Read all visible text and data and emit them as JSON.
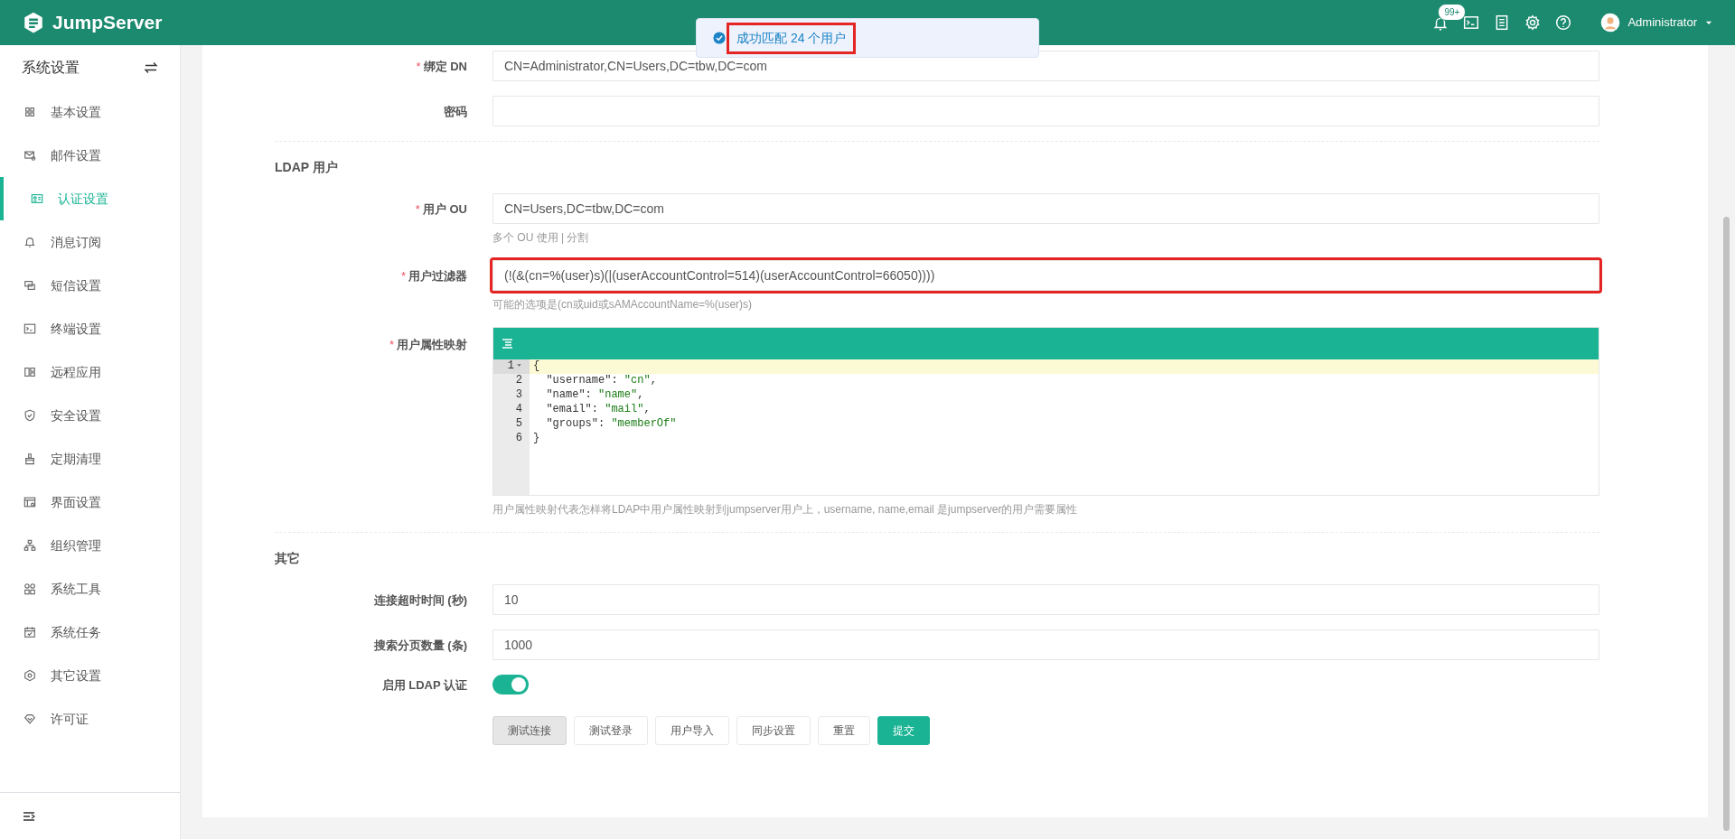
{
  "header": {
    "logo": "JumpServer",
    "notification_count": "99+",
    "user": "Administrator"
  },
  "toast": {
    "message": "成功匹配 24 个用户",
    "highlighted": true
  },
  "sidebar": {
    "title": "系统设置",
    "items": [
      {
        "label": "基本设置",
        "selected": false
      },
      {
        "label": "邮件设置",
        "selected": false
      },
      {
        "label": "认证设置",
        "selected": true
      },
      {
        "label": "消息订阅",
        "selected": false
      },
      {
        "label": "短信设置",
        "selected": false
      },
      {
        "label": "终端设置",
        "selected": false
      },
      {
        "label": "远程应用",
        "selected": false
      },
      {
        "label": "安全设置",
        "selected": false
      },
      {
        "label": "定期清理",
        "selected": false
      },
      {
        "label": "界面设置",
        "selected": false
      },
      {
        "label": "组织管理",
        "selected": false
      },
      {
        "label": "系统工具",
        "selected": false
      },
      {
        "label": "系统任务",
        "selected": false
      },
      {
        "label": "其它设置",
        "selected": false
      },
      {
        "label": "许可证",
        "selected": false
      }
    ]
  },
  "form": {
    "sections": [
      {
        "rows": [
          {
            "kind": "input",
            "marker": "*",
            "label": "绑定 DN",
            "value": "CN=Administrator,CN=Users,DC=tbw,DC=com",
            "highlighted": false
          },
          {
            "kind": "input",
            "label": "密码",
            "highlighted": false
          }
        ]
      },
      {
        "title": "LDAP 用户",
        "rows": [
          {
            "kind": "input",
            "marker": "*",
            "label": "用户 OU",
            "value": "CN=Users,DC=tbw,DC=com",
            "help": "多个 OU 使用 | 分割",
            "highlighted": false
          },
          {
            "kind": "input",
            "marker": "*",
            "label": "用户过滤器",
            "value": "(!(&(cn=%(user)s)(|(userAccountControl=514)(userAccountControl=66050))))",
            "help": "可能的选项是(cn或uid或sAMAccountName=%(user)s)",
            "highlighted": true
          },
          {
            "kind": "editor",
            "marker": "*",
            "label": "用户属性映射",
            "help": "用户属性映射代表怎样将LDAP中用户属性映射到jumpserver用户上，username, name,email 是jumpserver的用户需要属性",
            "lines": [
              {
                "number": "1",
                "active": true,
                "foldable": true,
                "segments": [
                  {
                    "text": "{",
                    "kind": "plain"
                  }
                ]
              },
              {
                "number": "2",
                "active": false,
                "foldable": false,
                "segments": [
                  {
                    "text": "  \"username\": ",
                    "kind": "plain"
                  },
                  {
                    "text": "\"cn\"",
                    "kind": "string"
                  },
                  {
                    "text": ",",
                    "kind": "plain"
                  }
                ]
              },
              {
                "number": "3",
                "active": false,
                "foldable": false,
                "segments": [
                  {
                    "text": "  \"name\": ",
                    "kind": "plain"
                  },
                  {
                    "text": "\"name\"",
                    "kind": "string"
                  },
                  {
                    "text": ",",
                    "kind": "plain"
                  }
                ]
              },
              {
                "number": "4",
                "active": false,
                "foldable": false,
                "segments": [
                  {
                    "text": "  \"email\": ",
                    "kind": "plain"
                  },
                  {
                    "text": "\"mail\"",
                    "kind": "string"
                  },
                  {
                    "text": ",",
                    "kind": "plain"
                  }
                ]
              },
              {
                "number": "5",
                "active": false,
                "foldable": false,
                "segments": [
                  {
                    "text": "  \"groups\": ",
                    "kind": "plain"
                  },
                  {
                    "text": "\"memberOf\"",
                    "kind": "string"
                  }
                ]
              },
              {
                "number": "6",
                "active": false,
                "foldable": false,
                "segments": [
                  {
                    "text": "}",
                    "kind": "plain"
                  }
                ]
              }
            ]
          }
        ]
      },
      {
        "title": "其它",
        "rows": [
          {
            "kind": "input",
            "label": "连接超时时间 (秒)",
            "value": "10",
            "highlighted": false
          },
          {
            "kind": "input",
            "label": "搜索分页数量 (条)",
            "value": "1000",
            "highlighted": false
          },
          {
            "kind": "toggle",
            "label": "启用 LDAP 认证",
            "on": true
          }
        ]
      }
    ],
    "buttons": [
      {
        "label": "测试连接",
        "kind": "default",
        "active": true
      },
      {
        "label": "测试登录",
        "kind": "default",
        "active": false
      },
      {
        "label": "用户导入",
        "kind": "default",
        "active": false
      },
      {
        "label": "同步设置",
        "kind": "default",
        "active": false
      },
      {
        "label": "重置",
        "kind": "default",
        "active": false
      },
      {
        "label": "提交",
        "kind": "primary",
        "active": false
      }
    ]
  }
}
